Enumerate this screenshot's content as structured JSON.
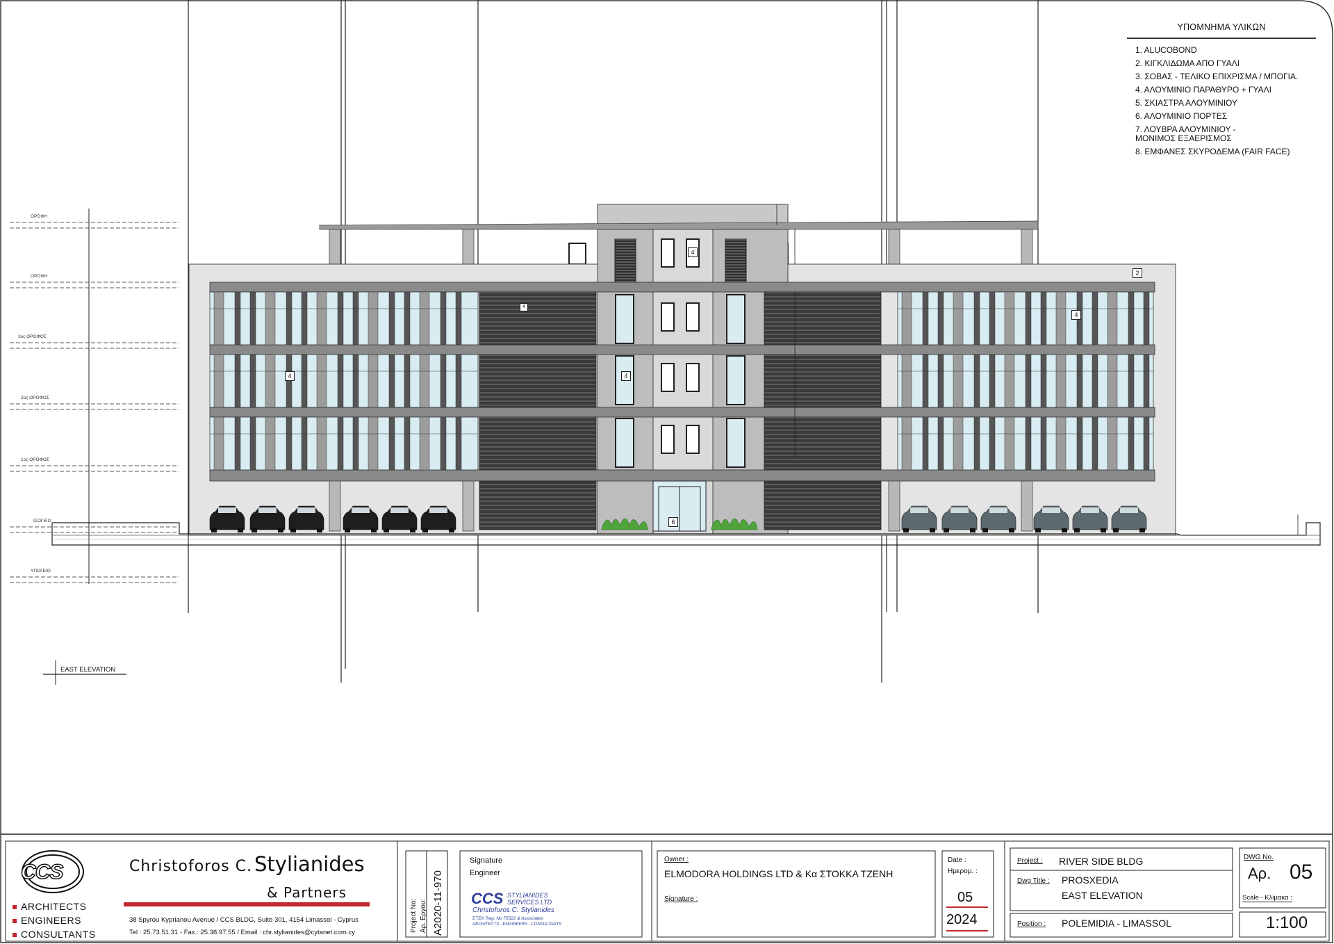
{
  "legend": {
    "title": "ΥΠΟΜΝΗΜΑ ΥΛΙΚΩΝ",
    "items": [
      "1. ALUCOBOND",
      "2. ΚΙΓΚΛΙΔΩΜΑ ΑΠΟ ΓΥΑΛΙ",
      "3. ΣΟΒΑΣ - ΤΕΛΙΚΟ ΕΠΙΧΡΙΣΜΑ / ΜΠΟΓΙΑ.",
      "4. ΑΛΟΥΜΙΝΙΟ ΠΑΡΑΘΥΡΟ + ΓΥΑΛΙ",
      "5. ΣΚΙΑΣΤΡΑ ΑΛΟΥΜΙΝΙΟΥ",
      "6. ΑΛΟΥΜΙΝΙΟ ΠΟΡΤΕΣ",
      "7. ΛΟΥΒΡΑ ΑΛΟΥΜΙΝΙΟΥ -\nΜΟΝΙΜΟΣ ΕΞΑΕΡΙΣΜΟΣ",
      "8. ΕΜΦΑΝΕΣ ΣΚΥΡΟΔΕΜΑ (FAIR FACE)"
    ]
  },
  "levels": [
    "ΟΡΟΦΗ",
    "ΟΡΟΦΗ",
    "3ος ΟΡΟΦΟΣ",
    "2ος ΟΡΟΦΟΣ",
    "1ος ΟΡΟΦΟΣ",
    "ΙΣΟΓΕΙΟ",
    "ΥΠΟΓΕΙΟ"
  ],
  "drawing_label": "EAST ELEVATION",
  "tags": [
    "4",
    "4",
    "4",
    "4",
    "4",
    "2",
    "6"
  ],
  "title_block": {
    "firm_first": "Christoforos C.",
    "firm_last": "Stylianides",
    "firm_partners": "& Partners",
    "roles": [
      "ARCHITECTS",
      "ENGINEERS",
      "CONSULTANTS"
    ],
    "address": "38 Spyrou Kyprianou Avenue   /   CCS BLDG, Suite 301, 4154 Limassol - Cyprus",
    "contact": "Tel : 25.73.51.31  -  Fax.: 25.38.97.55  /  Email :  chr.stylianides@cytanet.com.cy",
    "logo_text": "CCS",
    "project_no_label_en": "Project No:",
    "project_no_label_gr": "Αρ. Εργου:",
    "project_no": "A2020-11-970",
    "signature_label": "Signature",
    "engineer_label": "Engineer",
    "stamp_big": "CCS",
    "stamp_company": "STYLIANIDES",
    "stamp_company2": "SERVICES LTD",
    "stamp_name": "Christoforos C. Stylianides",
    "stamp_reg": "ETEK Reg. No 75522 & Associates",
    "stamp_role": "ARCHITECTS - ENGINEERS - CONSULTANTS",
    "owner_label": "Owner :",
    "owner": "ELMODORA HOLDINGS LTD   & Κα ΣΤΟΚΚΑ ΤΖΕΝΗ",
    "owner_signature_label": "Signature :",
    "date_label": "Date :",
    "date_label_gr": "Ημερομ. :",
    "date_month": "05",
    "date_year": "2024",
    "project_label": "Project :",
    "project": "RIVER SIDE BLDG",
    "dwg_title_label": "Dwg Title :",
    "dwg_title_1": "PROSXEDIA",
    "dwg_title_2": "EAST  ELEVATION",
    "position_label": "Position :",
    "position": "POLEMIDIA - LIMASSOL",
    "dwg_no_label": "DWG No.",
    "dwg_no_prefix": "Αρ.",
    "dwg_no": "05",
    "scale_label": "Scale - Κλίμακα :",
    "scale": "1:100"
  }
}
